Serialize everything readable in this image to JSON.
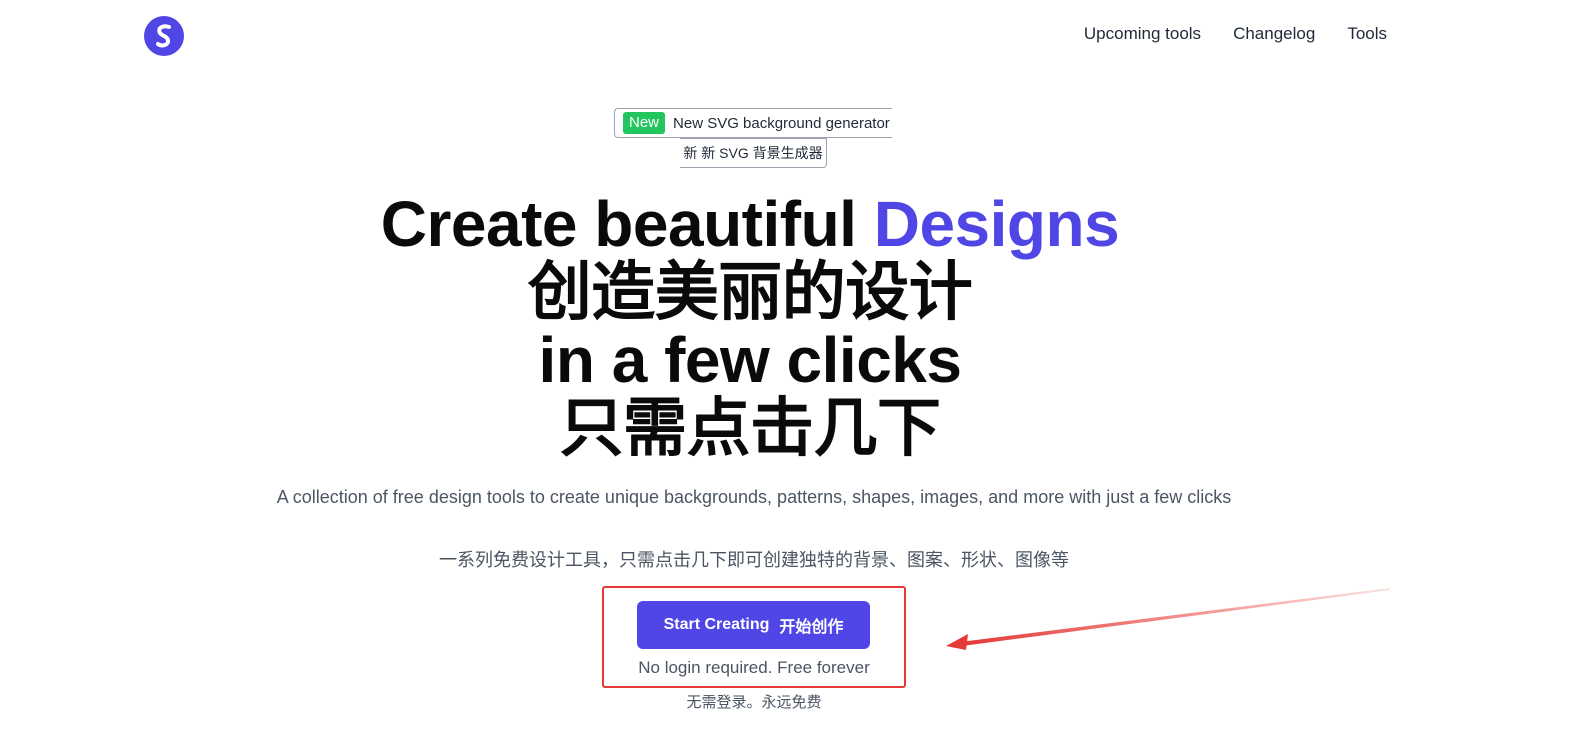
{
  "header": {
    "logo_icon": "logo-s-icon",
    "nav": [
      {
        "label": "Upcoming tools"
      },
      {
        "label": "Changelog"
      },
      {
        "label": "Tools"
      }
    ]
  },
  "announcement": {
    "badge": "New",
    "text": "New SVG background generator",
    "text_cn": "新 新 SVG 背景生成器"
  },
  "hero": {
    "line1_prefix": "Create beautiful ",
    "line1_accent": "Designs",
    "line2": "创造美丽的设计",
    "line3": "in a few clicks",
    "line4": "只需点击几下"
  },
  "description": {
    "en": "A collection of free design tools to create unique backgrounds, patterns, shapes, images, and more with just a few clicks",
    "cn": "一系列免费设计工具，只需点击几下即可创建独特的背景、图案、形状、图像等"
  },
  "cta": {
    "label": "Start Creating",
    "label_cn": "开始创作",
    "note": "No login required. Free forever",
    "note_cn": "无需登录。永远免费"
  },
  "colors": {
    "brand": "#5046e5",
    "new_badge": "#22c55e",
    "annotation": "#e53935"
  }
}
